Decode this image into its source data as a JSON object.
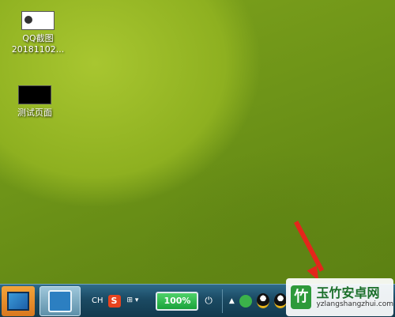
{
  "desktop": {
    "icons": [
      {
        "line1": "QQ截图",
        "line2": "20181102..."
      },
      {
        "line1": "测试页面",
        "line2": ""
      }
    ]
  },
  "taskbar": {
    "lang": "CH",
    "ime": "S",
    "ime_menu": "⊞\n▾",
    "battery": "100%",
    "plug": "⏻",
    "tray_up": "▲"
  },
  "watermark": {
    "logo": "竹",
    "title": "玉竹安卓网",
    "url": "yzlangshangzhui.com"
  },
  "colors": {
    "accent": "#e3261b",
    "battery": "#19a23a",
    "watermark": "#1a6f2a"
  }
}
